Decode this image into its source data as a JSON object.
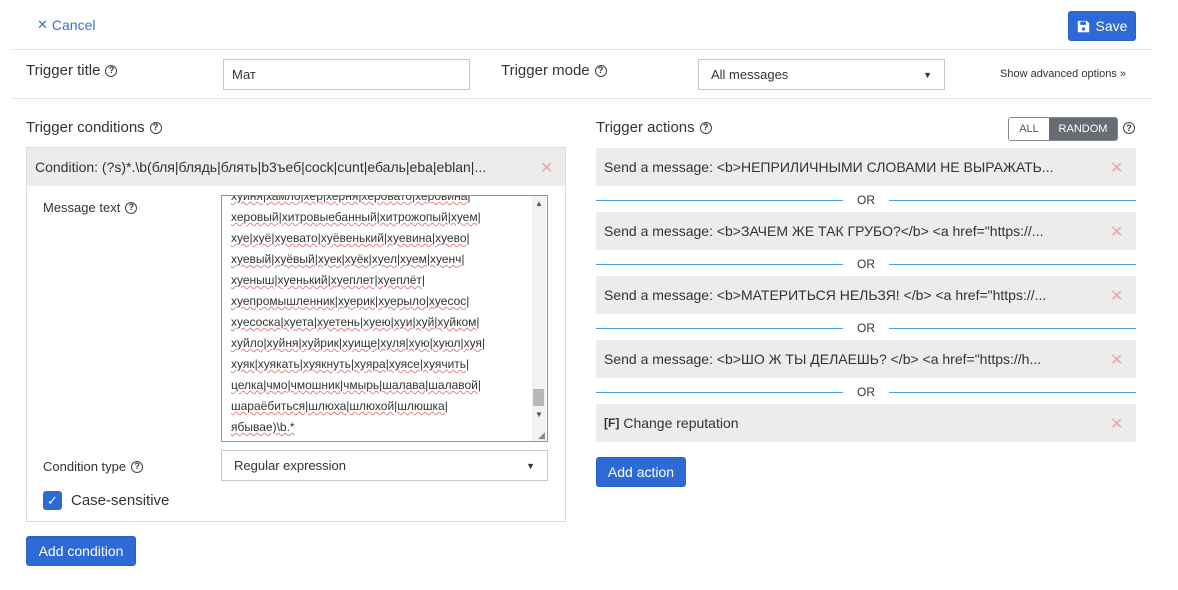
{
  "header": {
    "cancel_label": "Cancel",
    "save_label": "Save"
  },
  "settings": {
    "title_label": "Trigger title",
    "title_value": "Мат",
    "mode_label": "Trigger mode",
    "mode_value": "All messages",
    "advanced_link": "Show advanced options »"
  },
  "conditions": {
    "label": "Trigger conditions",
    "condition_header": "Condition: (?s)*.\\b(бля|блядь|блять|b3ъеб|cock|cunt|ебаль|eba|eblan|...",
    "message_text_label": "Message text",
    "message_lines": [
      "хуиня|хамло|хер|херня|херовато|херовина|",
      "херовый|хитровыебанный|хитрожопый|хуем|",
      "хуе|хуё|хуевато|хуёвенький|хуевина|хуево|",
      "хуевый|хуёвый|хуек|хуёк|хуел|хуем|хуенч|",
      "хуеныш|хуенький|хуеплет|хуеплёт|",
      "хуепромышленник|хуерик|хуерыло|хуесос|",
      "хуесоска|хуета|хуетень|хуею|хуи|хуй|хуйком|",
      "хуйло|хуйня|хуйрик|хуище|хуля|хую|хуюл|хуя|",
      "хуяк|хуякать|хуякнуть|хуяра|хуясе|хуячить|",
      "целка|чмо|чмошник|чмырь|шалава|шалавой|",
      "шараёбиться|шлюха|шлюхой|шлюшка|",
      "ябывае)\\b.*"
    ],
    "condition_type_label": "Condition type",
    "condition_type_value": "Regular expression",
    "case_sensitive_label": "Case-sensitive",
    "case_sensitive_checked": true,
    "add_label": "Add condition"
  },
  "actions": {
    "label": "Trigger actions",
    "mode_options": [
      "ALL",
      "RANDOM"
    ],
    "mode_selected": "RANDOM",
    "items": [
      "Send a message: <b>НЕПРИЛИЧНЫМИ СЛОВАМИ НЕ ВЫРАЖАТЬ...",
      "Send a message: <b>ЗАЧЕМ ЖЕ ТАК ГРУБО?</b> <a href=\"https://...",
      "Send a message: <b>МАТЕРИТЬСЯ НЕЛЬЗЯ! </b> <a href=\"https://...",
      "Send a message: <b>ШО Ж ТЫ ДЕЛАЕШЬ? </b> <a href=\"https://h...",
      "Change reputation"
    ],
    "reputation_prefix": "[F]",
    "or_label": "OR",
    "add_label": "Add action"
  },
  "colors": {
    "primary": "#2d6ad6",
    "link": "#3b6fd0",
    "danger_icon": "#f1a7a7",
    "or_line": "#4a9be0"
  }
}
